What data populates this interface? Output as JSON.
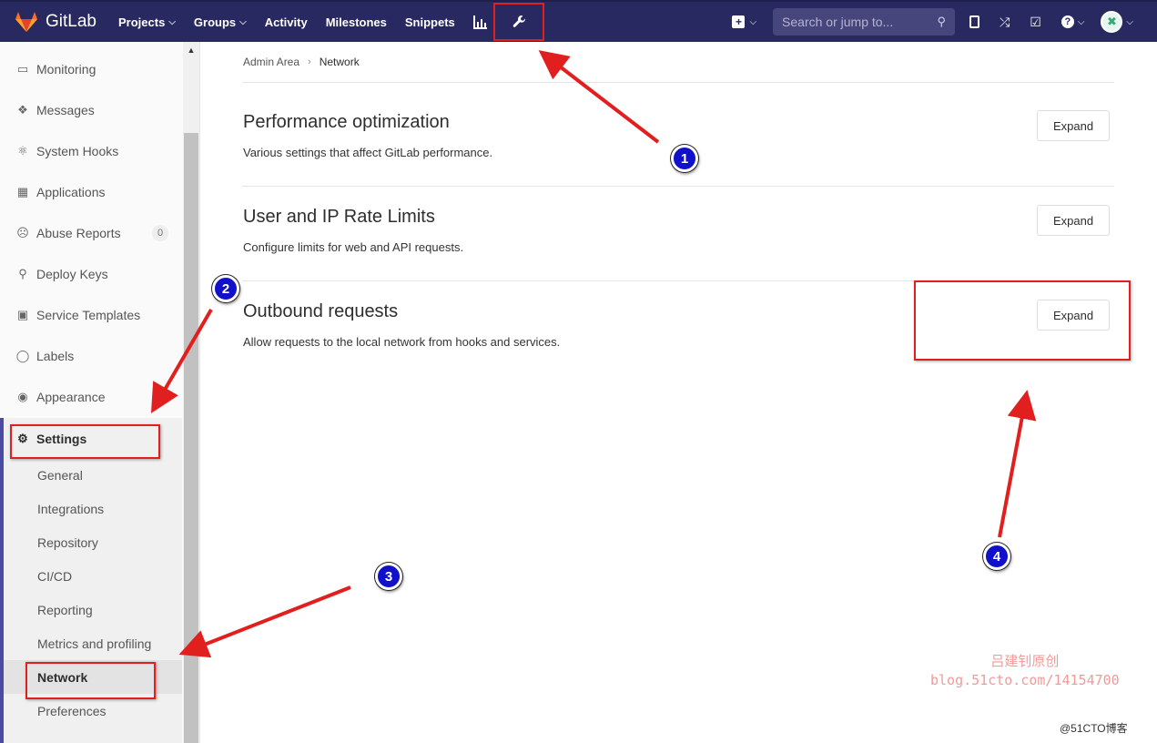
{
  "topnav": {
    "brand": "GitLab",
    "links": [
      {
        "label": "Projects",
        "caret": true
      },
      {
        "label": "Groups",
        "caret": true
      },
      {
        "label": "Activity",
        "caret": false
      },
      {
        "label": "Milestones",
        "caret": false
      },
      {
        "label": "Snippets",
        "caret": false
      }
    ],
    "search_placeholder": "Search or jump to...",
    "colors": {
      "nav_bg": "#292961",
      "brand_orange": "#e24329"
    }
  },
  "sidebar": {
    "items": [
      {
        "label": "Monitoring",
        "icon": "monitor-icon"
      },
      {
        "label": "Messages",
        "icon": "broadcast-icon"
      },
      {
        "label": "System Hooks",
        "icon": "hook-icon"
      },
      {
        "label": "Applications",
        "icon": "grid-icon"
      },
      {
        "label": "Abuse Reports",
        "icon": "frown-icon",
        "badge": "0"
      },
      {
        "label": "Deploy Keys",
        "icon": "key-icon"
      },
      {
        "label": "Service Templates",
        "icon": "template-icon"
      },
      {
        "label": "Labels",
        "icon": "label-icon"
      },
      {
        "label": "Appearance",
        "icon": "palette-icon"
      }
    ],
    "settings": {
      "label": "Settings",
      "icon": "gear-icon",
      "subitems": [
        "General",
        "Integrations",
        "Repository",
        "CI/CD",
        "Reporting",
        "Metrics and profiling",
        "Network",
        "Preferences"
      ],
      "active": "Network"
    }
  },
  "breadcrumb": {
    "parent": "Admin Area",
    "current": "Network"
  },
  "sections": [
    {
      "title": "Performance optimization",
      "description": "Various settings that affect GitLab performance.",
      "button": "Expand"
    },
    {
      "title": "User and IP Rate Limits",
      "description": "Configure limits for web and API requests.",
      "button": "Expand"
    },
    {
      "title": "Outbound requests",
      "description": "Allow requests to the local network from hooks and services.",
      "button": "Expand"
    }
  ],
  "annotations": {
    "badges": [
      "1",
      "2",
      "3",
      "4"
    ],
    "arrow_color": "#e21f1f",
    "badge_color": "#1111cc"
  },
  "watermark": {
    "line1": "吕建钊原创",
    "line2": "blog.51cto.com/14154700"
  },
  "corner_mark": "@51CTO博客"
}
